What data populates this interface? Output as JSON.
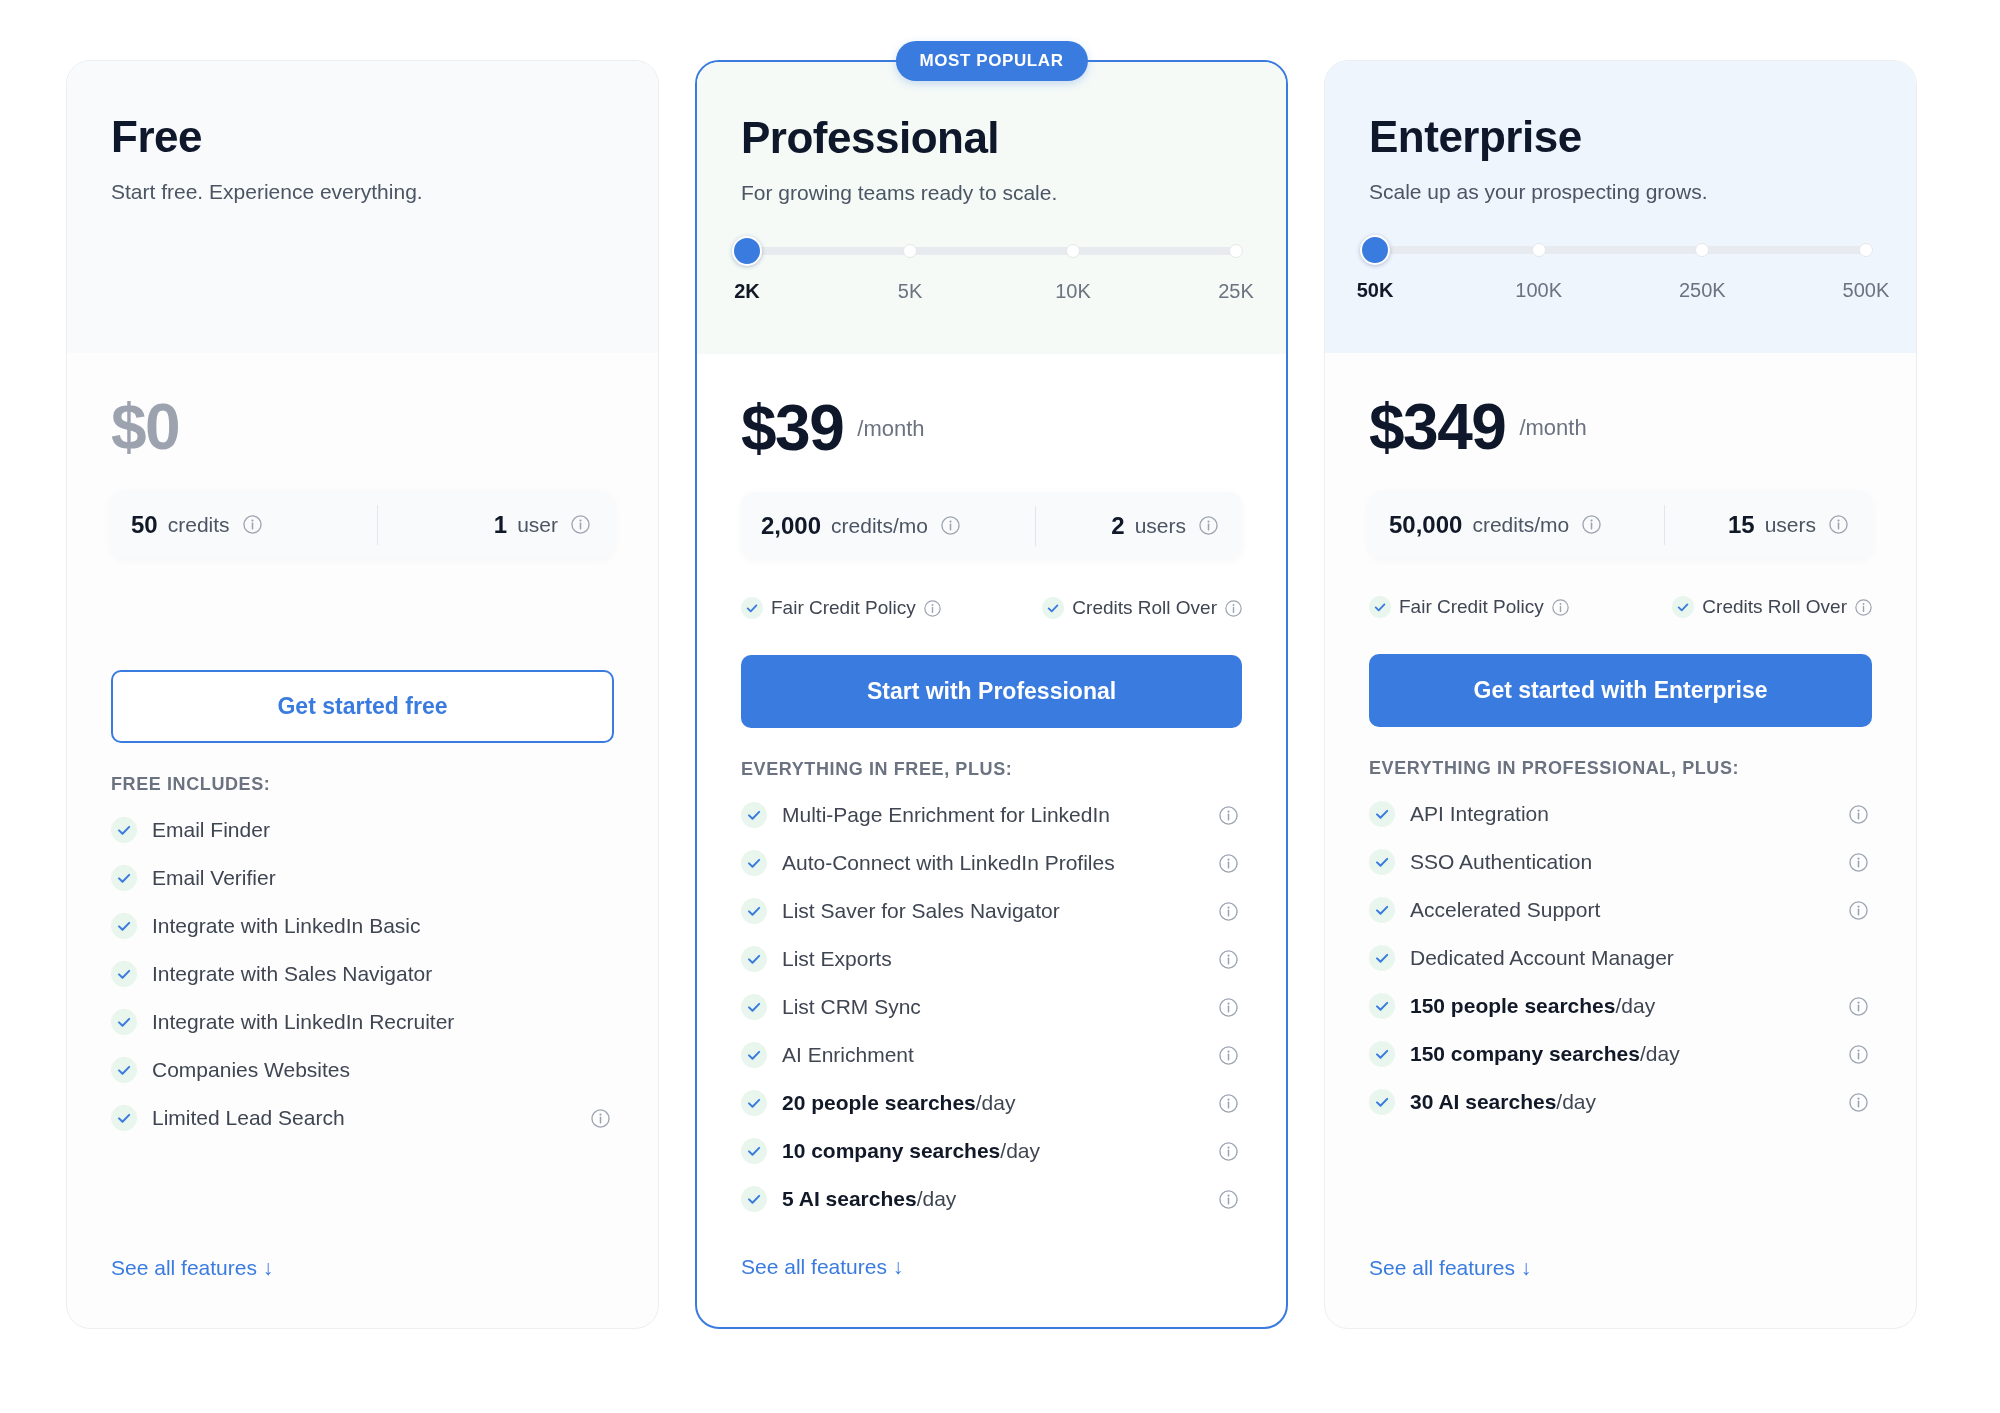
{
  "plans": [
    {
      "name": "Free",
      "tagline": "Start free. Experience everything.",
      "highlighted": false,
      "price": "$0",
      "price_muted": true,
      "credits": {
        "amount": "50",
        "unit": "credits"
      },
      "users": {
        "amount": "1",
        "unit": "user"
      },
      "button": {
        "label": "Get started free",
        "kind": "outline"
      },
      "features_heading": "FREE INCLUDES:",
      "features": [
        {
          "text": "Email Finder",
          "info": false
        },
        {
          "text": "Email Verifier",
          "info": false
        },
        {
          "text": "Integrate with LinkedIn Basic",
          "info": false
        },
        {
          "text": "Integrate with Sales Navigator",
          "info": false
        },
        {
          "text": "Integrate with LinkedIn Recruiter",
          "info": false
        },
        {
          "text": "Companies Websites",
          "info": false
        },
        {
          "text": "Limited Lead Search",
          "info": true
        }
      ],
      "link": "See all features ↓"
    },
    {
      "name": "Professional",
      "badge": "MOST POPULAR",
      "tagline": "For growing teams ready to scale.",
      "highlighted": true,
      "slider": {
        "level": 0,
        "stops": [
          {
            "label": "2K",
            "selected": true
          },
          {
            "label": "5K",
            "selected": false
          },
          {
            "label": "10K",
            "selected": false
          },
          {
            "label": "25K",
            "selected": false
          }
        ]
      },
      "price": "$39",
      "period": "/month",
      "price_muted": false,
      "credits": {
        "amount": "2,000",
        "unit": "credits/mo"
      },
      "users": {
        "amount": "2",
        "unit": "users"
      },
      "policies": [
        {
          "label": "Fair Credit Policy",
          "info": true
        },
        {
          "label": "Credits Roll Over",
          "info": true
        }
      ],
      "button": {
        "label": "Start with Professional",
        "kind": "filled"
      },
      "features_heading": "EVERYTHING IN FREE, PLUS:",
      "features": [
        {
          "text": "Multi-Page Enrichment for LinkedIn",
          "info": true
        },
        {
          "text": "Auto-Connect with LinkedIn Profiles",
          "info": true
        },
        {
          "text": "List Saver for Sales Navigator",
          "info": true
        },
        {
          "text": "List Exports",
          "info": true
        },
        {
          "text": "List CRM Sync",
          "info": true
        },
        {
          "text": "AI Enrichment",
          "info": true
        },
        {
          "text": "**20 people searches**/day",
          "info": true
        },
        {
          "text": "**10 company searches**/day",
          "info": true
        },
        {
          "text": "**5 AI searches**/day",
          "info": true
        }
      ],
      "link": "See all features ↓"
    },
    {
      "name": "Enterprise",
      "tagline": "Scale up as your prospecting grows.",
      "highlighted": false,
      "slider": {
        "level": 0,
        "stops": [
          {
            "label": "50K",
            "selected": true
          },
          {
            "label": "100K",
            "selected": false
          },
          {
            "label": "250K",
            "selected": false
          },
          {
            "label": "500K",
            "selected": false
          }
        ]
      },
      "price": "$349",
      "period": "/month",
      "price_muted": false,
      "credits": {
        "amount": "50,000",
        "unit": "credits/mo"
      },
      "users": {
        "amount": "15",
        "unit": "users"
      },
      "policies": [
        {
          "label": "Fair Credit Policy",
          "info": true
        },
        {
          "label": "Credits Roll Over",
          "info": true
        }
      ],
      "button": {
        "label": "Get started with Enterprise",
        "kind": "filled"
      },
      "features_heading": "EVERYTHING IN PROFESSIONAL, PLUS:",
      "features": [
        {
          "text": "API Integration",
          "info": true
        },
        {
          "text": "SSO Authentication",
          "info": true
        },
        {
          "text": "Accelerated Support",
          "info": true
        },
        {
          "text": "Dedicated Account Manager",
          "info": false
        },
        {
          "text": "**150 people searches**/day",
          "info": true
        },
        {
          "text": "**150 company searches**/day",
          "info": true
        },
        {
          "text": "**30 AI searches**/day",
          "info": true
        }
      ],
      "link": "See all features ↓"
    }
  ]
}
